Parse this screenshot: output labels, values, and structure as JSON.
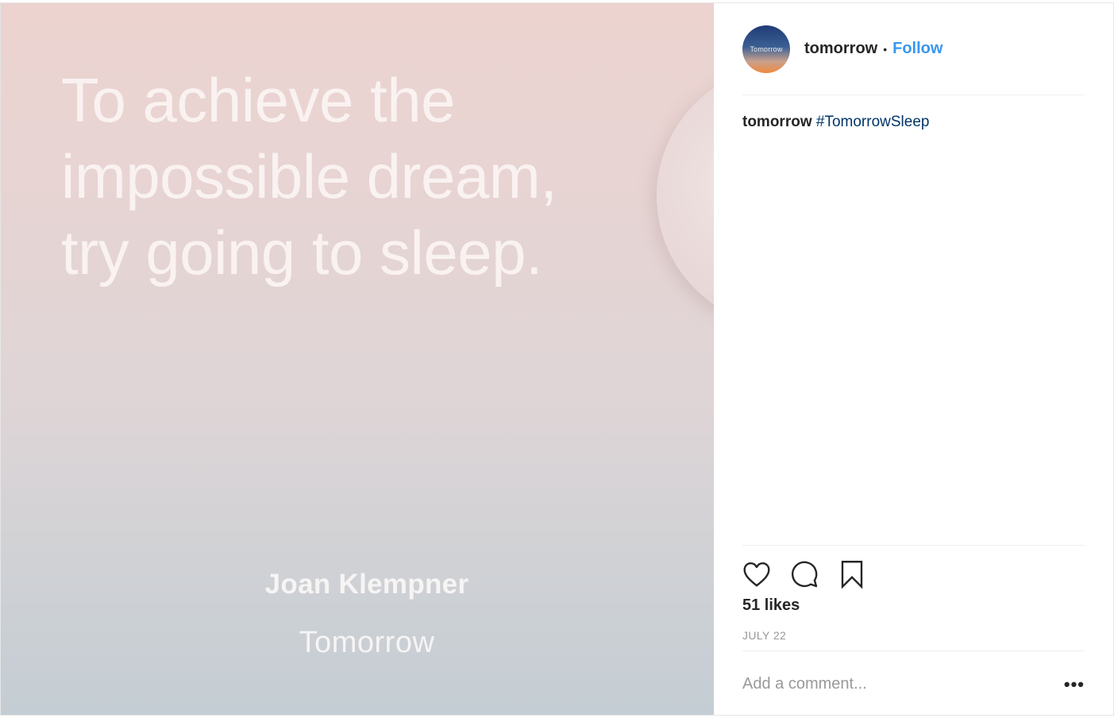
{
  "image": {
    "quote_lines": [
      "To achieve the",
      "impossible dream,",
      "try going to sleep."
    ],
    "author": "Joan Klempner",
    "brand": "Tomorrow"
  },
  "header": {
    "avatar_text": "Tomorrow",
    "username": "tomorrow",
    "separator": "•",
    "follow_label": "Follow"
  },
  "caption": {
    "username": "tomorrow",
    "hashtag": "#TomorrowSleep"
  },
  "actions": {
    "like_icon": "heart-icon",
    "comment_icon": "comment-icon",
    "save_icon": "bookmark-icon"
  },
  "likes": "51 likes",
  "date": "JULY 22",
  "comment": {
    "placeholder": "Add a comment...",
    "more_label": "•••"
  },
  "colors": {
    "link": "#3897f0",
    "hashtag": "#003569",
    "text": "#262626",
    "muted": "#999999"
  }
}
